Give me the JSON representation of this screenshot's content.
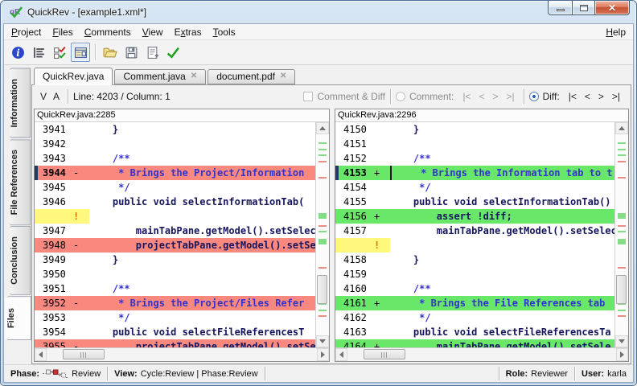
{
  "window": {
    "title": "QuickRev - [example1.xml*]"
  },
  "menu": {
    "items": [
      {
        "label": "Project",
        "accel": 0
      },
      {
        "label": "Files",
        "accel": 0
      },
      {
        "label": "Comments",
        "accel": 0
      },
      {
        "label": "View",
        "accel": 0
      },
      {
        "label": "Extras",
        "accel": 1
      },
      {
        "label": "Tools",
        "accel": 0
      }
    ],
    "help": {
      "label": "Help",
      "accel": 0
    }
  },
  "toolbar": {
    "icons": [
      "info-icon",
      "comment-list-icon",
      "checklist-icon",
      "file-view-toggle-icon",
      "open-folder-icon",
      "save-icon",
      "report-icon",
      "validate-check-icon"
    ],
    "pressed_index": 3
  },
  "side_tabs": [
    {
      "label": "Information",
      "active": false
    },
    {
      "label": "File References",
      "active": false
    },
    {
      "label": "Conclusion",
      "active": false
    },
    {
      "label": "Files",
      "active": true
    }
  ],
  "doc_tabs": [
    {
      "label": "QuickRev.java",
      "active": true,
      "closable": false
    },
    {
      "label": "Comment.java",
      "active": false,
      "closable": true
    },
    {
      "label": "document.pdf",
      "active": false,
      "closable": true
    }
  ],
  "subtoolbar": {
    "v": "V",
    "a": "A",
    "caret_status": "Line: 4203 / Column: 1",
    "comment_diff_label": "Comment & Diff",
    "comment_label": "Comment:",
    "diff_label": "Diff:",
    "nav": [
      "|<",
      "<",
      ">",
      ">|"
    ]
  },
  "panes": [
    {
      "header": "QuickRev.java:2285",
      "vthumb_pct": 70,
      "hthumb_pct": 6,
      "lines": [
        {
          "num": "3941",
          "mark": "",
          "text": "    }",
          "kind": "code",
          "bg": "none"
        },
        {
          "num": "3942",
          "mark": "",
          "text": "",
          "kind": "code",
          "bg": "none"
        },
        {
          "num": "3943",
          "mark": "",
          "text": "    /**",
          "kind": "comment",
          "bg": "none"
        },
        {
          "num": "3944",
          "mark": "-",
          "text": "     * Brings the Project/Information",
          "kind": "comment",
          "bg": "removed",
          "current": true
        },
        {
          "num": "3945",
          "mark": "",
          "text": "     */",
          "kind": "comment",
          "bg": "none"
        },
        {
          "num": "3946",
          "mark": "",
          "text": "    public void selectInformationTab(",
          "kind": "code",
          "bg": "none"
        },
        {
          "num": "",
          "mark": "!",
          "text": "",
          "kind": "code",
          "bg": "note"
        },
        {
          "num": "3947",
          "mark": "",
          "text": "        mainTabPane.getModel().setSelec",
          "kind": "code",
          "bg": "none"
        },
        {
          "num": "3948",
          "mark": "-",
          "text": "        projectTabPane.getModel().setSe",
          "kind": "code",
          "bg": "removed"
        },
        {
          "num": "3949",
          "mark": "",
          "text": "    }",
          "kind": "code",
          "bg": "none"
        },
        {
          "num": "3950",
          "mark": "",
          "text": "",
          "kind": "code",
          "bg": "none"
        },
        {
          "num": "3951",
          "mark": "",
          "text": "    /**",
          "kind": "comment",
          "bg": "none"
        },
        {
          "num": "3952",
          "mark": "-",
          "text": "     * Brings the Project/Files Refer",
          "kind": "comment",
          "bg": "removed"
        },
        {
          "num": "3953",
          "mark": "",
          "text": "     */",
          "kind": "comment",
          "bg": "none"
        },
        {
          "num": "3954",
          "mark": "",
          "text": "    public void selectFileReferencesT",
          "kind": "code",
          "bg": "none"
        },
        {
          "num": "3955",
          "mark": "-",
          "text": "        projectTabPane.getModel().setSel",
          "kind": "code",
          "bg": "removed",
          "partial": true
        }
      ]
    },
    {
      "header": "QuickRev.java:2296",
      "vthumb_pct": 70,
      "hthumb_pct": 6,
      "lines": [
        {
          "num": "4150",
          "mark": "",
          "text": "    }",
          "kind": "code",
          "bg": "none"
        },
        {
          "num": "4151",
          "mark": "",
          "text": "",
          "kind": "code",
          "bg": "none"
        },
        {
          "num": "4152",
          "mark": "",
          "text": "    /**",
          "kind": "comment",
          "bg": "none"
        },
        {
          "num": "4153",
          "mark": "+",
          "text": "     * Brings the Information tab to t",
          "kind": "comment",
          "bg": "added",
          "current": true,
          "caret": true
        },
        {
          "num": "4154",
          "mark": "",
          "text": "     */",
          "kind": "comment",
          "bg": "none"
        },
        {
          "num": "4155",
          "mark": "",
          "text": "    public void selectInformationTab()",
          "kind": "code",
          "bg": "none"
        },
        {
          "num": "4156",
          "mark": "+",
          "text": "        assert !diff;",
          "kind": "code",
          "bg": "added"
        },
        {
          "num": "4157",
          "mark": "",
          "text": "        mainTabPane.getModel().setSelect",
          "kind": "code",
          "bg": "none"
        },
        {
          "num": "",
          "mark": "!",
          "text": "",
          "kind": "code",
          "bg": "note"
        },
        {
          "num": "4158",
          "mark": "",
          "text": "    }",
          "kind": "code",
          "bg": "none"
        },
        {
          "num": "4159",
          "mark": "",
          "text": "",
          "kind": "code",
          "bg": "none"
        },
        {
          "num": "4160",
          "mark": "",
          "text": "    /**",
          "kind": "comment",
          "bg": "none"
        },
        {
          "num": "4161",
          "mark": "+",
          "text": "     * Brings the File References tab",
          "kind": "comment",
          "bg": "added"
        },
        {
          "num": "4162",
          "mark": "",
          "text": "     */",
          "kind": "comment",
          "bg": "none"
        },
        {
          "num": "4163",
          "mark": "",
          "text": "    public void selectFileReferencesTa",
          "kind": "code",
          "bg": "none"
        },
        {
          "num": "4164",
          "mark": "+",
          "text": "        mainTabPane.getModel().setSele",
          "kind": "code",
          "bg": "added",
          "partial": true
        }
      ]
    }
  ],
  "scroll_marks": [
    {
      "p": 4,
      "c": "g"
    },
    {
      "p": 7,
      "c": "g"
    },
    {
      "p": 10,
      "c": "g"
    },
    {
      "p": 13,
      "c": "r"
    },
    {
      "p": 21,
      "c": "r"
    },
    {
      "p": 39,
      "c": "G"
    },
    {
      "p": 45,
      "c": "r"
    },
    {
      "p": 48,
      "c": "g"
    },
    {
      "p": 52,
      "c": "G"
    },
    {
      "p": 66,
      "c": "r"
    },
    {
      "p": 70,
      "c": "g"
    },
    {
      "p": 73,
      "c": "g"
    },
    {
      "p": 77,
      "c": "r"
    },
    {
      "p": 84,
      "c": "g"
    },
    {
      "p": 87,
      "c": "g"
    },
    {
      "p": 90,
      "c": "r"
    }
  ],
  "statusbar": {
    "phase_label": "Phase:",
    "phase_value": "Review",
    "view_label": "View:",
    "view_value": "Cycle:Review | Phase:Review",
    "role_label": "Role:",
    "role_value": "Reviewer",
    "user_label": "User:",
    "user_value": "karla"
  },
  "colors": {
    "removed_bg": "#F9887F",
    "added_bg": "#68E768",
    "note_bg": "#FFF87D",
    "note_mark": "#C87800",
    "comment_text": "#3333CC",
    "code_text": "#16165E",
    "current_edge": "#1E3C64",
    "scroll_mark_green": "#86DC86",
    "scroll_mark_red": "#E88C86"
  }
}
